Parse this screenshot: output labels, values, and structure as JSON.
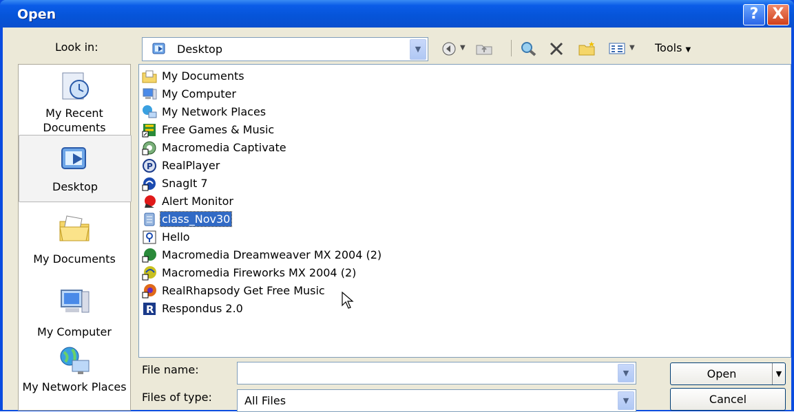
{
  "window": {
    "title": "Open"
  },
  "titlebar": {
    "help_label": "?",
    "close_label": "X"
  },
  "toolbar": {
    "look_in_label": "Look in:",
    "look_in_value": "Desktop",
    "tools_label": "Tools"
  },
  "places": [
    {
      "label": "My Recent Documents",
      "icon": "recent-documents-icon"
    },
    {
      "label": "Desktop",
      "icon": "desktop-icon"
    },
    {
      "label": "My Documents",
      "icon": "my-documents-icon"
    },
    {
      "label": "My Computer",
      "icon": "my-computer-icon"
    },
    {
      "label": "My Network Places",
      "icon": "network-places-icon"
    }
  ],
  "files": [
    {
      "name": "My Documents",
      "icon": "my-documents-icon"
    },
    {
      "name": "My Computer",
      "icon": "my-computer-icon"
    },
    {
      "name": "My Network Places",
      "icon": "network-places-icon"
    },
    {
      "name": "Free Games & Music",
      "icon": "games-shortcut-icon"
    },
    {
      "name": "Macromedia Captivate",
      "icon": "captivate-icon"
    },
    {
      "name": "RealPlayer",
      "icon": "realplayer-icon"
    },
    {
      "name": "SnagIt 7",
      "icon": "snagit-icon"
    },
    {
      "name": "Alert Monitor",
      "icon": "alert-monitor-icon"
    },
    {
      "name": "class_Nov30",
      "icon": "document-icon",
      "selected": true
    },
    {
      "name": "Hello",
      "icon": "hello-icon"
    },
    {
      "name": "Macromedia Dreamweaver MX 2004 (2)",
      "icon": "dreamweaver-icon"
    },
    {
      "name": "Macromedia Fireworks MX 2004 (2)",
      "icon": "fireworks-icon"
    },
    {
      "name": "RealRhapsody Get Free Music",
      "icon": "rhapsody-icon"
    },
    {
      "name": "Respondus 2.0",
      "icon": "respondus-icon"
    }
  ],
  "form": {
    "file_name_label": "File name:",
    "file_name_value": "",
    "file_type_label": "Files of type:",
    "file_type_value": "All Files"
  },
  "buttons": {
    "open_label": "Open",
    "cancel_label": "Cancel"
  }
}
